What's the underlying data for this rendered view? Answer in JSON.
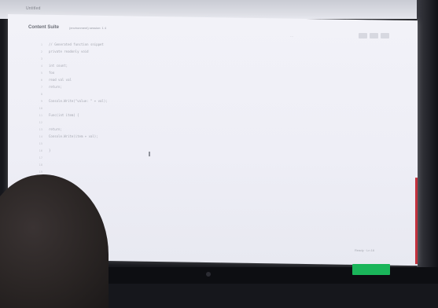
{
  "app": {
    "window_title": "Untitled"
  },
  "editor": {
    "file_name": "Content Suite",
    "file_meta": "(environment) session: 1 4",
    "mode_label": "···",
    "code_lines": [
      {
        "ln": "1",
        "text": "  // Generated function snippet"
      },
      {
        "ln": "2",
        "text": "    private readonly void"
      },
      {
        "ln": "3",
        "text": ""
      },
      {
        "ln": "4",
        "text": "  int count;"
      },
      {
        "ln": "5",
        "text": "  foo"
      },
      {
        "ln": "6",
        "text": "          read val val"
      },
      {
        "ln": "7",
        "text": "          return;"
      },
      {
        "ln": "8",
        "text": ""
      },
      {
        "ln": "9",
        "text": "          Console.Write(\"value: \" + val);"
      },
      {
        "ln": "10",
        "text": ""
      },
      {
        "ln": "11",
        "text": "          Func(int item) {"
      },
      {
        "ln": "12",
        "text": ""
      },
      {
        "ln": "13",
        "text": "              return;"
      },
      {
        "ln": "14",
        "text": "              Console.Write(item + val);"
      },
      {
        "ln": "15",
        "text": ""
      },
      {
        "ln": "16",
        "text": "          }"
      },
      {
        "ln": "17",
        "text": ""
      },
      {
        "ln": "18",
        "text": ""
      },
      {
        "ln": "19",
        "text": ""
      }
    ]
  },
  "status": {
    "text": "Ready · Ln 16"
  },
  "colors": {
    "screen_bg": "#f0f0f7",
    "submit_green": "#1ab55a",
    "edge_red": "#c2313d"
  }
}
